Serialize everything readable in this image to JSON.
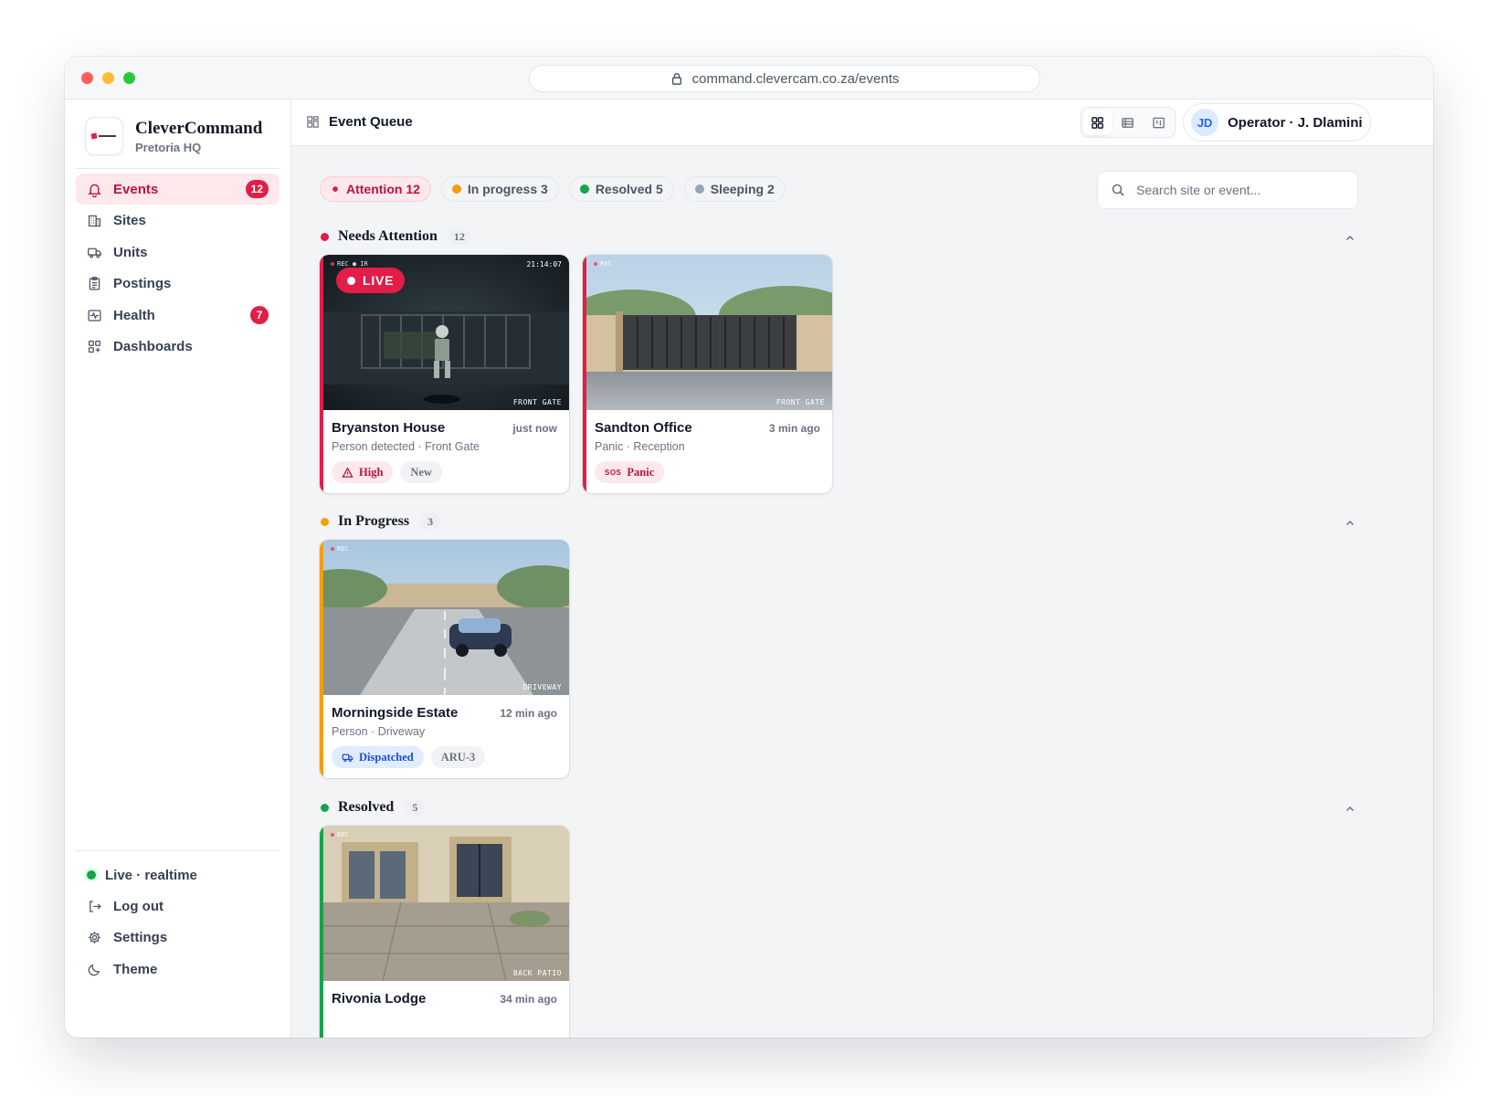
{
  "url": "command.clevercam.co.za/events",
  "brand": {
    "name": "CleverCommand",
    "sub": "Pretoria HQ"
  },
  "nav": [
    {
      "label": "Events",
      "badge": "12",
      "icon": "bell-icon"
    },
    {
      "label": "Sites",
      "badge": "",
      "icon": "building-icon"
    },
    {
      "label": "Units",
      "badge": "",
      "icon": "truck-icon"
    },
    {
      "label": "Postings",
      "badge": "",
      "icon": "clipboard-icon"
    },
    {
      "label": "Health",
      "badge": "7",
      "icon": "pulse-icon"
    },
    {
      "label": "Dashboards",
      "badge": "",
      "icon": "dashboard-grid-icon"
    }
  ],
  "footer": {
    "live": "Live · realtime",
    "logout": "Log out",
    "settings": "Settings",
    "theme": "Theme"
  },
  "header": {
    "title": "Event Queue",
    "operator": "Operator · J. Dlamini",
    "initials": "JD"
  },
  "filters": [
    {
      "label": "Attention 12",
      "color": "#e11d48"
    },
    {
      "label": "In progress 3",
      "color": "#f59e0b"
    },
    {
      "label": "Resolved 5",
      "color": "#16a34a"
    },
    {
      "label": "Sleeping 2",
      "color": "#94a3b8"
    }
  ],
  "search": {
    "placeholder": "Search site or event..."
  },
  "sections": [
    {
      "title": "Needs Attention",
      "count": "12",
      "color": "#e11d48"
    },
    {
      "title": "In Progress",
      "count": "3",
      "color": "#f59e0b"
    },
    {
      "title": "Resolved",
      "count": "5",
      "color": "#16a34a"
    }
  ],
  "cards": [
    {
      "site": "Bryanston House",
      "ago": "just now",
      "meta": "Person detected · Front Gate",
      "cam": "FRONT GATE",
      "rec": "REC ● IR",
      "clock": "21:14:07",
      "live": "LIVE",
      "tags": [
        "High",
        "New"
      ]
    },
    {
      "site": "Sandton Office",
      "ago": "3 min ago",
      "meta": "Panic · Reception",
      "cam": "FRONT GATE",
      "rec": "REC",
      "sos": "SOS",
      "tags": [
        "Panic"
      ]
    },
    {
      "site": "Morningside Estate",
      "ago": "12 min ago",
      "meta": "Person · Driveway",
      "cam": "DRIVEWAY",
      "rec": "REC",
      "tags": [
        "Dispatched",
        "ARU-3"
      ]
    },
    {
      "site": "Rivonia Lodge",
      "ago": "34 min ago",
      "cam": "BACK PATIO",
      "rec": "REC"
    }
  ],
  "colors": {
    "attention": "#e11d48",
    "progress": "#f59e0b",
    "resolved": "#16a34a",
    "accent_blue": "#2563eb"
  }
}
